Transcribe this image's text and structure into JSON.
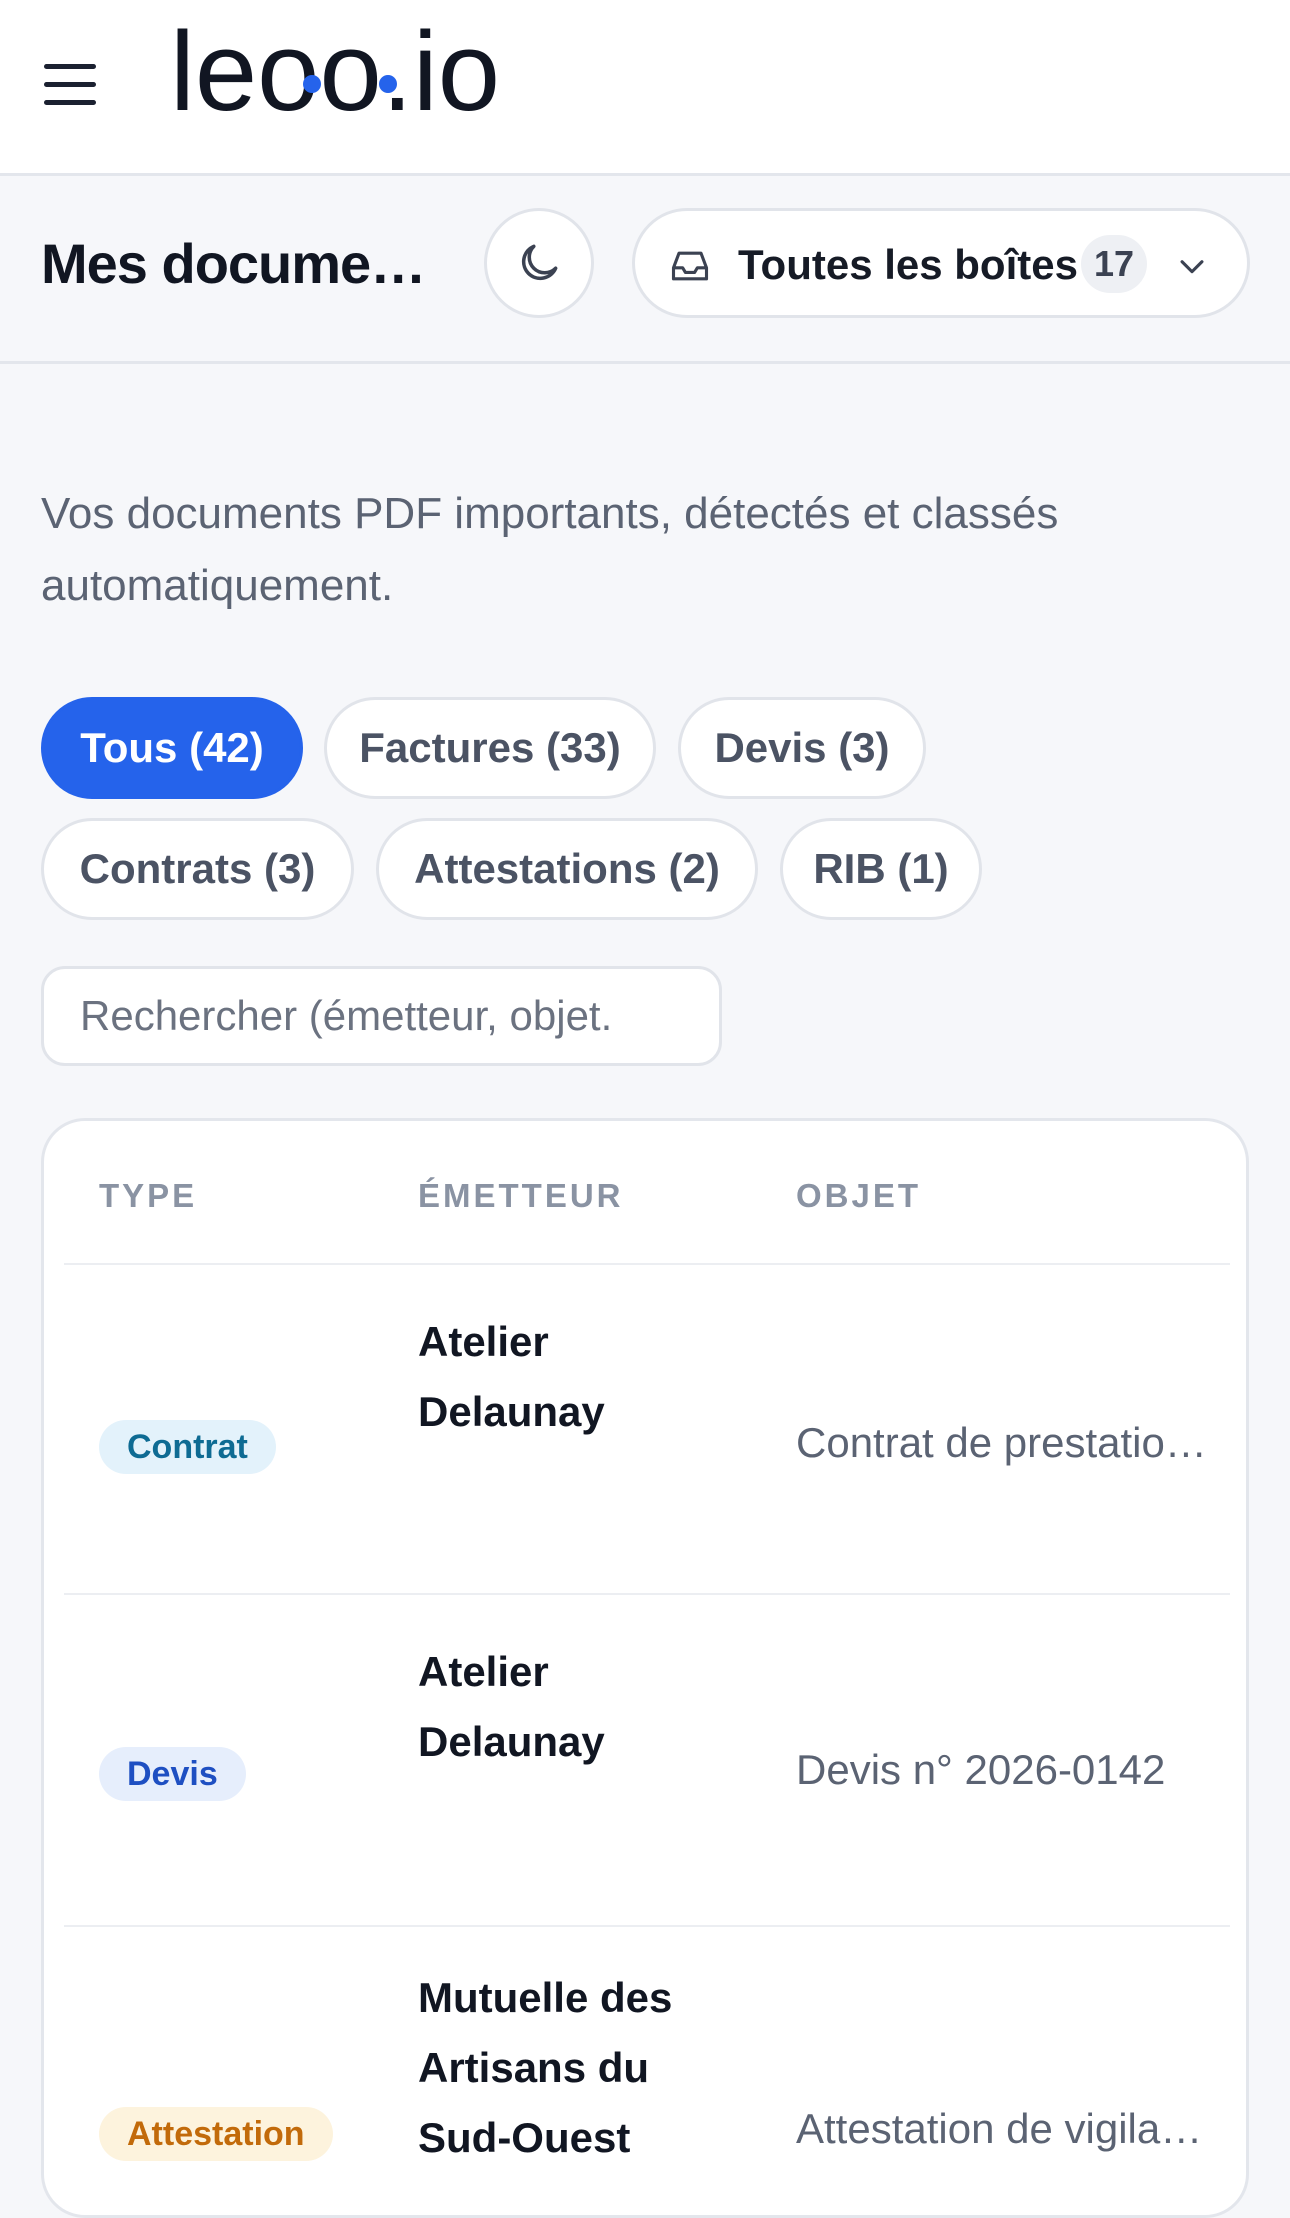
{
  "header": {
    "logo_text": "leoo.io",
    "brand_color": "#2563eb"
  },
  "pagehead": {
    "title": "Mes documents",
    "mailbox_label": "Toutes les boîtes",
    "mailbox_count": "17"
  },
  "subtitle": "Vos documents PDF importants, détectés et classés automatiquement.",
  "filters": [
    {
      "label": "Tous (42)",
      "active": true
    },
    {
      "label": "Factures (33)",
      "active": false
    },
    {
      "label": "Devis (3)",
      "active": false
    },
    {
      "label": "Contrats (3)",
      "active": false
    },
    {
      "label": "Attestations (2)",
      "active": false
    },
    {
      "label": "RIB (1)",
      "active": false
    }
  ],
  "search": {
    "placeholder": "Rechercher (émetteur, objet."
  },
  "table": {
    "columns": [
      "TYPE",
      "ÉMETTEUR",
      "OBJET"
    ],
    "rows": [
      {
        "type": "Contrat",
        "emitter": "Atelier Delaunay",
        "objet": "Contrat de prestation de services"
      },
      {
        "type": "Devis",
        "emitter": "Atelier Delaunay",
        "objet": "Devis n° 2026-0142"
      },
      {
        "type": "Attestation",
        "emitter": "Mutuelle des Artisans du Sud-Ouest",
        "objet": "Attestation de vigilance"
      }
    ]
  },
  "badge_colors": {
    "Contrat": {
      "bg": "#e3f2fb",
      "fg": "#0e6b93"
    },
    "Devis": {
      "bg": "#e6eefc",
      "fg": "#1e4fc2"
    },
    "Attestation": {
      "bg": "#fdf3dd",
      "fg": "#c26a0a"
    }
  }
}
